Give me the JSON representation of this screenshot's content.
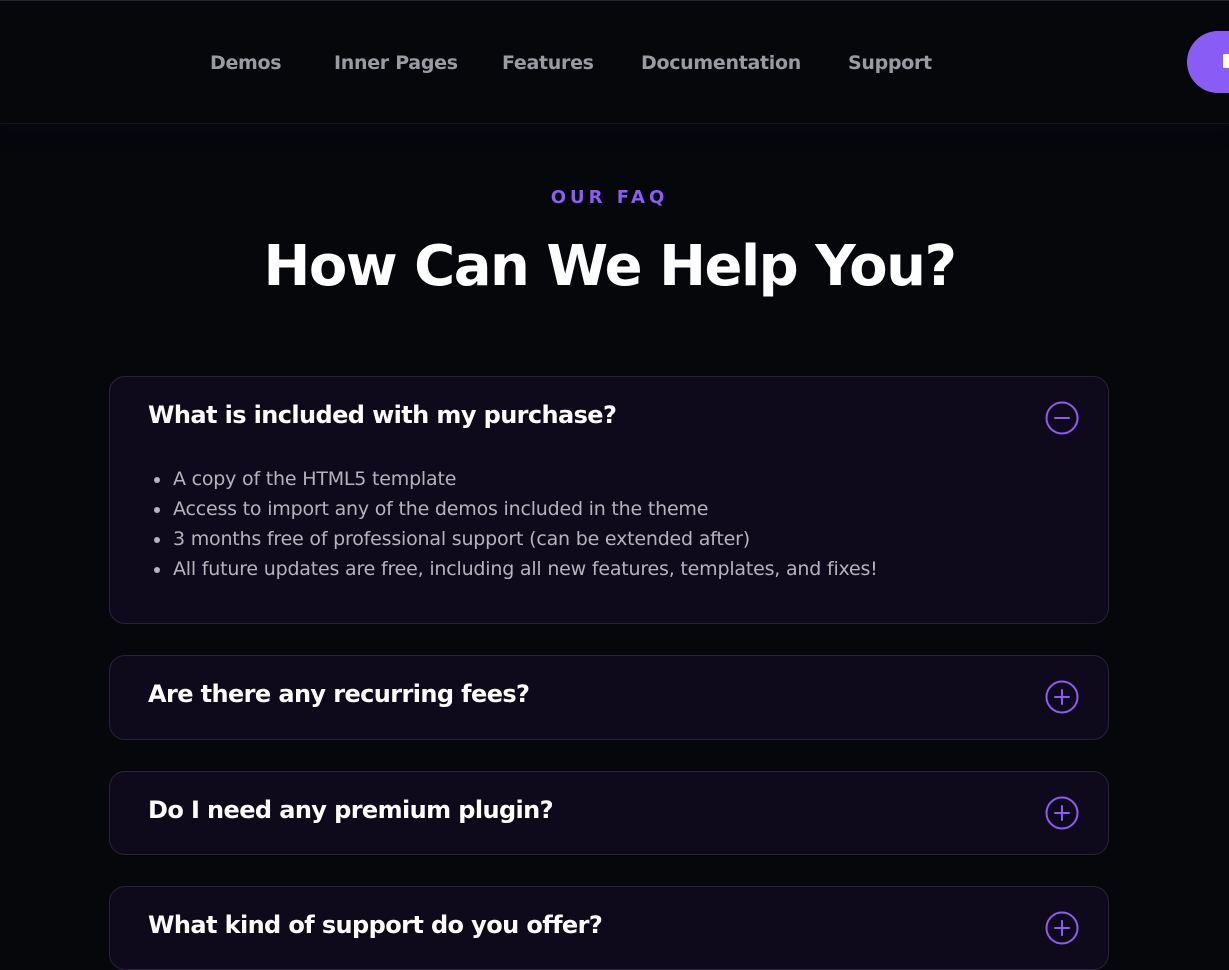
{
  "nav": {
    "items": [
      {
        "label": "Demos"
      },
      {
        "label": "Inner Pages"
      },
      {
        "label": "Features"
      },
      {
        "label": "Documentation"
      },
      {
        "label": "Support"
      }
    ]
  },
  "section": {
    "eyebrow": "OUR FAQ",
    "title": "How Can We Help You?"
  },
  "faq": {
    "items": [
      {
        "question": "What is included with my purchase?",
        "expanded": true,
        "answer": [
          "A copy of the HTML5 template",
          "Access to import any of the demos included in the theme",
          "3 months free of professional support (can be extended after)",
          "All future updates are free, including all new features, templates, and fixes!"
        ]
      },
      {
        "question": "Are there any recurring fees?",
        "expanded": false
      },
      {
        "question": "Do I need any premium plugin?",
        "expanded": false
      },
      {
        "question": "What kind of support do you offer?",
        "expanded": false
      }
    ]
  },
  "icons": {
    "collapse": "minus-circle-icon",
    "expand": "plus-circle-icon",
    "cta": "arrow-icon"
  },
  "colors": {
    "accent": "#8b5cf6",
    "background": "#05070b",
    "card": "#0f0a1b",
    "text": "#ffffff",
    "muted": "#b4b4bc"
  }
}
